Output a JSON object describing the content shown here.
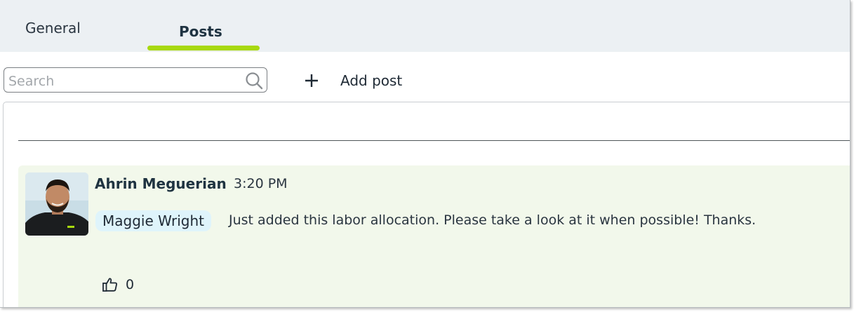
{
  "tabs": [
    {
      "label": "General",
      "active": false
    },
    {
      "label": "Posts",
      "active": true
    }
  ],
  "accent_color": "#a8d90f",
  "search": {
    "placeholder": "Search",
    "value": ""
  },
  "toolbar": {
    "add_post_label": "Add post"
  },
  "post": {
    "author": "Ahrin Meguerian",
    "time": "3:20 PM",
    "mention": "Maggie Wright",
    "message": "Just added this labor allocation. Please take a look at it when possible! Thanks.",
    "like_count": "0"
  },
  "icons": {
    "search": "search-icon",
    "add": "plus-icon",
    "like": "thumbs-up-icon"
  }
}
